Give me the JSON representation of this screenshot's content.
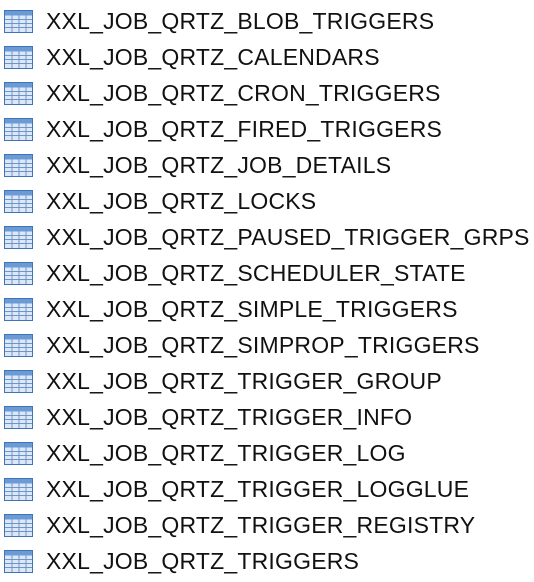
{
  "icon": "table-icon",
  "colors": {
    "icon_border": "#3f74b7",
    "icon_header": "#6b9ad6",
    "icon_cell": "#dce8f7",
    "icon_grid": "#6f96c9",
    "text": "#111111"
  },
  "tables": [
    "XXL_JOB_QRTZ_BLOB_TRIGGERS",
    "XXL_JOB_QRTZ_CALENDARS",
    "XXL_JOB_QRTZ_CRON_TRIGGERS",
    "XXL_JOB_QRTZ_FIRED_TRIGGERS",
    "XXL_JOB_QRTZ_JOB_DETAILS",
    "XXL_JOB_QRTZ_LOCKS",
    "XXL_JOB_QRTZ_PAUSED_TRIGGER_GRPS",
    "XXL_JOB_QRTZ_SCHEDULER_STATE",
    "XXL_JOB_QRTZ_SIMPLE_TRIGGERS",
    "XXL_JOB_QRTZ_SIMPROP_TRIGGERS",
    "XXL_JOB_QRTZ_TRIGGER_GROUP",
    "XXL_JOB_QRTZ_TRIGGER_INFO",
    "XXL_JOB_QRTZ_TRIGGER_LOG",
    "XXL_JOB_QRTZ_TRIGGER_LOGGLUE",
    "XXL_JOB_QRTZ_TRIGGER_REGISTRY",
    "XXL_JOB_QRTZ_TRIGGERS"
  ]
}
